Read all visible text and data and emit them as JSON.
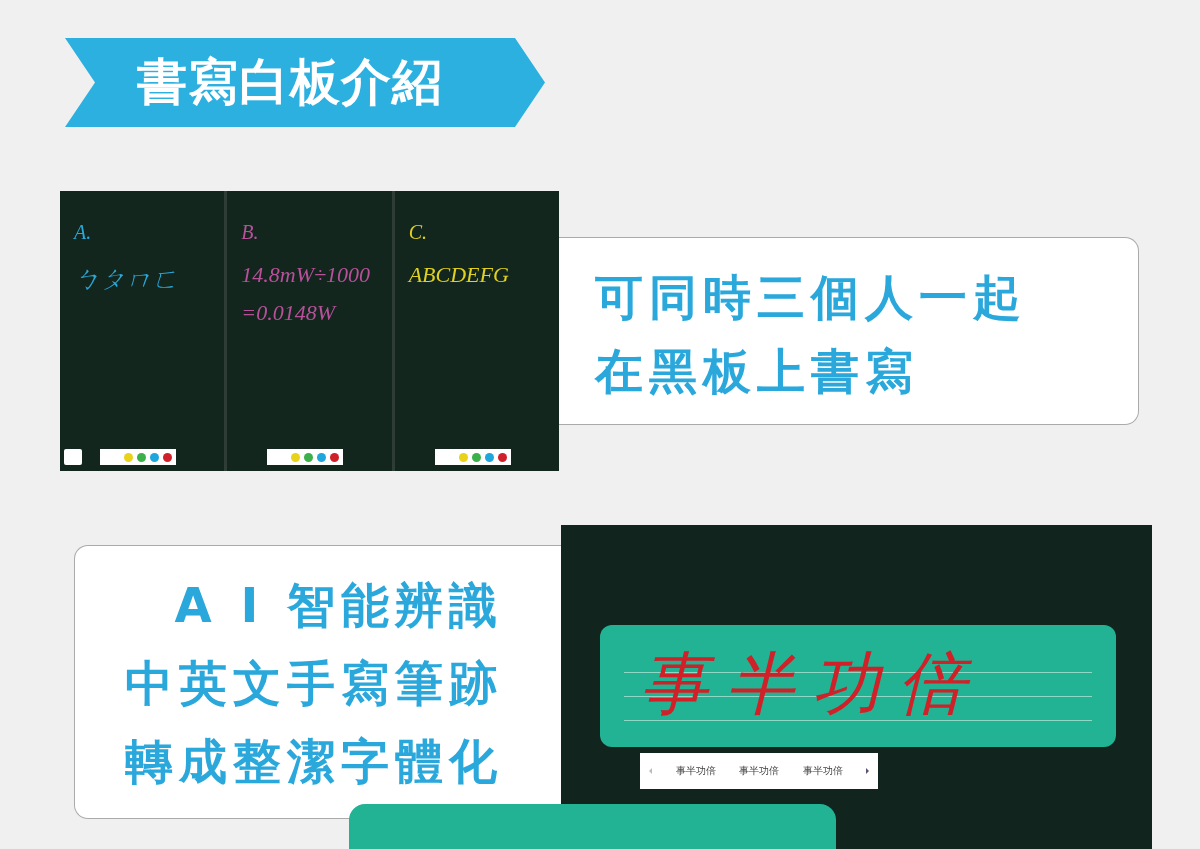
{
  "banner": {
    "title": "書寫白板介紹"
  },
  "feature_1": {
    "panels": [
      {
        "label": "A.",
        "lines": [
          "ㄅㄆㄇㄈ"
        ],
        "color": "#2aa8d8"
      },
      {
        "label": "B.",
        "lines": [
          "14.8mW÷1000",
          "=0.0148W"
        ],
        "color": "#b8509a"
      },
      {
        "label": "C.",
        "lines": [
          "ABCDEFG"
        ],
        "color": "#e0d020"
      }
    ],
    "caption": [
      "可同時三個人一起",
      "在黑板上書寫"
    ]
  },
  "feature_2": {
    "caption": [
      "A I 智能辨識",
      "中英文手寫筆跡",
      "轉成整潔字體化"
    ],
    "handwriting": "事半功倍",
    "suggestions": [
      "事半功倍",
      "事半功倍",
      "事半功倍"
    ]
  }
}
